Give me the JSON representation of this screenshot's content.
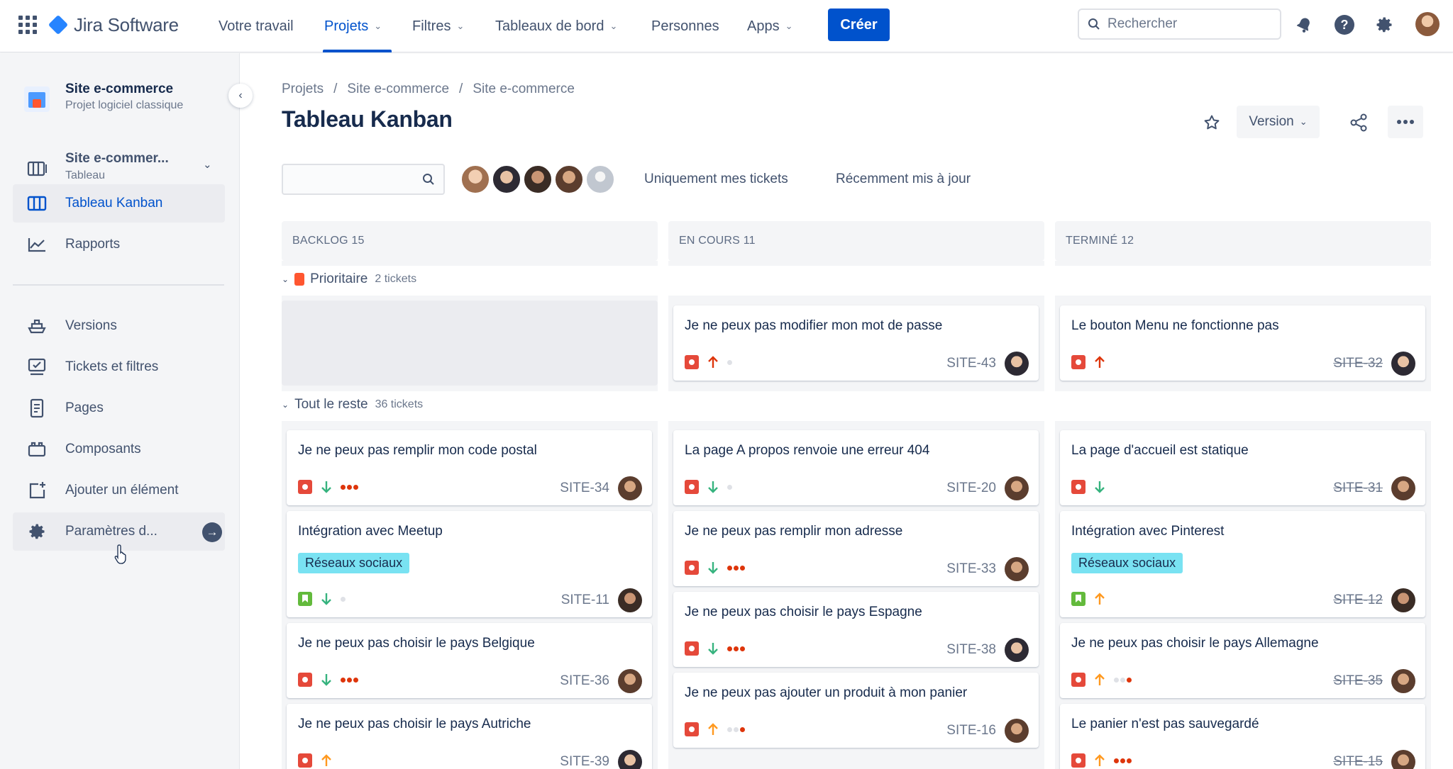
{
  "topnav": {
    "brand": "Jira Software",
    "items": [
      {
        "label": "Votre travail",
        "dropdown": false
      },
      {
        "label": "Projets",
        "dropdown": true,
        "active": true
      },
      {
        "label": "Filtres",
        "dropdown": true
      },
      {
        "label": "Tableaux de bord",
        "dropdown": true
      },
      {
        "label": "Personnes",
        "dropdown": false
      },
      {
        "label": "Apps",
        "dropdown": true
      }
    ],
    "create_label": "Créer",
    "search_placeholder": "Rechercher",
    "icons": [
      "app-switcher-icon",
      "notifications-icon",
      "help-icon",
      "settings-icon",
      "profile-avatar"
    ]
  },
  "sidebar": {
    "project_name": "Site e-commerce",
    "project_type": "Projet logiciel classique",
    "board_name": "Site e-commer...",
    "board_type": "Tableau",
    "items": [
      {
        "label": "Tableau Kanban",
        "icon": "board-icon",
        "selected": true
      },
      {
        "label": "Rapports",
        "icon": "reports-icon"
      },
      {
        "label": "Versions",
        "icon": "ship-icon"
      },
      {
        "label": "Tickets et filtres",
        "icon": "issues-icon"
      },
      {
        "label": "Pages",
        "icon": "page-icon"
      },
      {
        "label": "Composants",
        "icon": "component-icon"
      },
      {
        "label": "Ajouter un élément",
        "icon": "add-item-icon"
      },
      {
        "label": "Paramètres d...",
        "icon": "gear-icon"
      }
    ]
  },
  "main": {
    "breadcrumb": [
      "Projets",
      "/",
      "Site e-commerce",
      "/",
      "Site e-commerce"
    ],
    "title": "Tableau Kanban",
    "version_label": "Version",
    "filters": [
      "Uniquement mes tickets",
      "Récemment mis à jour"
    ]
  },
  "columns": [
    {
      "name": "BACKLOG",
      "count": "15"
    },
    {
      "name": "EN COURS",
      "count": "11"
    },
    {
      "name": "TERMINÉ",
      "count": "12"
    }
  ],
  "swimlanes": [
    {
      "name": "Prioritaire",
      "count": "2 tickets"
    },
    {
      "name": "Tout le reste",
      "count": "36 tickets"
    }
  ],
  "cards": [
    {
      "title": "Je ne peux pas modifier mon mot de passe",
      "key": "SITE-43",
      "type": "bug",
      "priority": "up",
      "priority_color": "#de350b",
      "estimate": 0
    },
    {
      "title": "Le bouton Menu ne fonctionne pas",
      "key": "SITE-32",
      "type": "bug",
      "priority": "up",
      "priority_color": "#de350b",
      "done": true
    },
    {
      "title": "Je ne peux pas remplir mon code postal",
      "key": "SITE-34",
      "type": "bug",
      "priority": "down",
      "priority_color": "#36b37e",
      "estimate": 3
    },
    {
      "title": "La page A propos renvoie une erreur 404",
      "key": "SITE-20",
      "type": "bug",
      "priority": "down",
      "priority_color": "#36b37e",
      "estimate": 0
    },
    {
      "title": "La page d'accueil est statique",
      "key": "SITE-31",
      "type": "bug",
      "priority": "down",
      "priority_color": "#36b37e",
      "done": true
    },
    {
      "title": "Intégration avec Meetup",
      "key": "SITE-11",
      "type": "story",
      "priority": "down",
      "priority_color": "#36b37e",
      "tag": "Réseaux sociaux",
      "estimate": 0
    },
    {
      "title": "Je ne peux pas remplir mon adresse",
      "key": "SITE-33",
      "type": "bug",
      "priority": "down",
      "priority_color": "#36b37e",
      "estimate": 3
    },
    {
      "title": "Intégration avec Pinterest",
      "key": "SITE-12",
      "type": "story",
      "priority": "up",
      "priority_color": "#ff991f",
      "tag": "Réseaux sociaux",
      "done": true
    },
    {
      "title": "Je ne peux pas choisir le pays Espagne",
      "key": "SITE-38",
      "type": "bug",
      "priority": "down",
      "priority_color": "#36b37e",
      "estimate": 3
    },
    {
      "title": "Je ne peux pas choisir le pays Belgique",
      "key": "SITE-36",
      "type": "bug",
      "priority": "down",
      "priority_color": "#36b37e",
      "estimate": 3
    },
    {
      "title": "Je ne peux pas choisir le pays Allemagne",
      "key": "SITE-35",
      "type": "bug",
      "priority": "up",
      "priority_color": "#ff991f",
      "estimate": 1,
      "done": true
    },
    {
      "title": "Je ne peux pas ajouter un produit à mon panier",
      "key": "SITE-16",
      "type": "bug",
      "priority": "up",
      "priority_color": "#ff991f",
      "estimate": 1
    },
    {
      "title": "Je ne peux pas choisir le pays Autriche",
      "key": "SITE-39",
      "type": "bug",
      "priority": "up",
      "priority_color": "#ff991f"
    },
    {
      "title": "Le panier n'est pas sauvegardé",
      "key": "SITE-15",
      "type": "bug",
      "priority": "up",
      "priority_color": "#ff991f",
      "estimate": 3,
      "done": true
    }
  ]
}
